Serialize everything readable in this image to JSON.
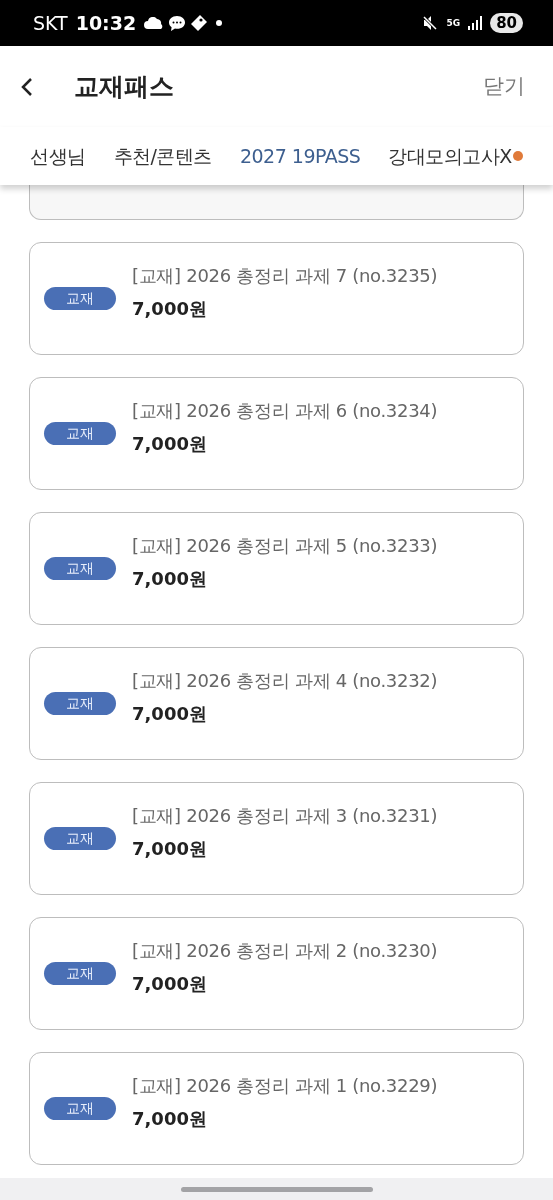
{
  "status_bar": {
    "carrier": "SKT",
    "time": "10:32",
    "network": "5G",
    "battery": "80"
  },
  "header": {
    "title": "교재패스",
    "close": "닫기"
  },
  "tabs": [
    {
      "label": "선생님",
      "selected": false
    },
    {
      "label": "추천/콘텐츠",
      "selected": false
    },
    {
      "label": "2027 19PASS",
      "selected": true
    },
    {
      "label": "강대모의고사X",
      "selected": false
    }
  ],
  "items": [
    {
      "badge": "교재",
      "title": "[교재] 2026 총정리 과제 7 (no.3235)",
      "price": "7,000원"
    },
    {
      "badge": "교재",
      "title": "[교재] 2026 총정리 과제 6 (no.3234)",
      "price": "7,000원"
    },
    {
      "badge": "교재",
      "title": "[교재] 2026 총정리 과제 5 (no.3233)",
      "price": "7,000원"
    },
    {
      "badge": "교재",
      "title": "[교재] 2026 총정리 과제 4 (no.3232)",
      "price": "7,000원"
    },
    {
      "badge": "교재",
      "title": "[교재] 2026 총정리 과제 3 (no.3231)",
      "price": "7,000원"
    },
    {
      "badge": "교재",
      "title": "[교재] 2026 총정리 과제 2 (no.3230)",
      "price": "7,000원"
    },
    {
      "badge": "교재",
      "title": "[교재] 2026 총정리 과제 1 (no.3229)",
      "price": "7,000원"
    }
  ]
}
